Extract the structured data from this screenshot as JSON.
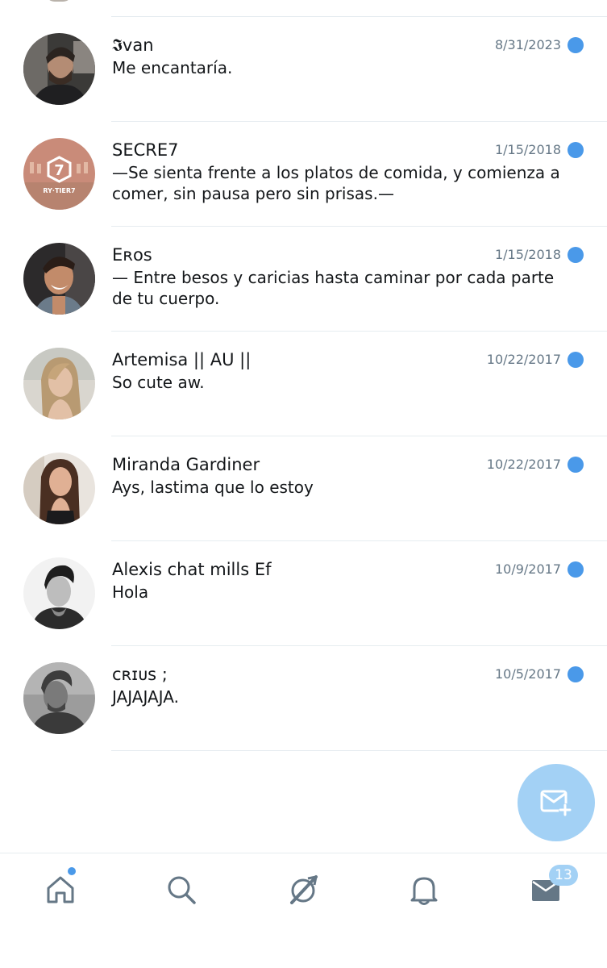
{
  "conversations": [
    {
      "name": "𝕴van",
      "date": "8/31/2023",
      "message": "Me encantaría.",
      "unread": true
    },
    {
      "name": "SECRE7",
      "date": "1/15/2018",
      "message": "—Se sienta frente a los platos de comida, y comienza a comer, sin pausa pero sin prisas.—",
      "unread": true
    },
    {
      "name": "Eʀᴏs",
      "date": "1/15/2018",
      "message": "— Entre besos y caricias hasta caminar por cada parte de tu cuerpo.",
      "unread": true
    },
    {
      "name": "Artemisa || AU ||",
      "date": "10/22/2017",
      "message": "So cute aw.",
      "unread": true
    },
    {
      "name": "Miranda Gardiner",
      "date": "10/22/2017",
      "message": "Ays, lastima que lo estoy",
      "unread": true
    },
    {
      "name": "Alexis chat mills Ef",
      "date": "10/9/2017",
      "message": "Hola",
      "unread": true
    },
    {
      "name": "ᴄʀɪᴜs ;",
      "date": "10/5/2017",
      "message": "JAJAJAJA.",
      "unread": true
    }
  ],
  "avatar_2_text": {
    "digit": "7",
    "caption": "RY·TIER7"
  },
  "compose": {
    "icon": "compose-message-icon"
  },
  "tabbar": {
    "items": [
      {
        "icon": "home-icon",
        "has_dot": true
      },
      {
        "icon": "search-icon"
      },
      {
        "icon": "moments-icon"
      },
      {
        "icon": "bell-icon"
      },
      {
        "icon": "mail-icon",
        "active": true
      }
    ],
    "messages_badge": "13"
  },
  "colors": {
    "accent": "#4a99e9",
    "accent_light": "#a3d1f5",
    "text": "#14171a",
    "secondary_text": "#657786",
    "separator": "#e6ecf0",
    "icon_gray": "#657786"
  }
}
